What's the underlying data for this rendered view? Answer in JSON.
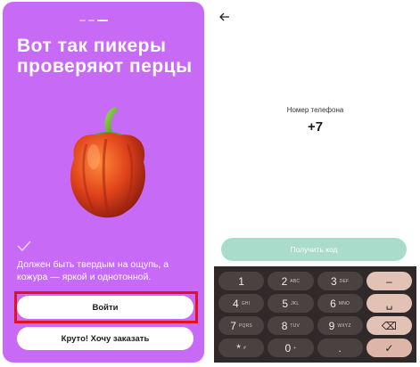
{
  "onboarding": {
    "headline": "Вот так пикеры проверяют перцы",
    "description": "Должен быть твердым на ощупь, а кожура — яркой и однотонной.",
    "login_button": "Войти",
    "order_button": "Круто! Хочу заказать",
    "pager_total": 3,
    "pager_active": 3,
    "pepper_icon": "red-bell-pepper",
    "check_icon": "check-icon"
  },
  "phone_screen": {
    "back_icon": "arrow-left-icon",
    "phone_label": "Номер телефона",
    "phone_value": "+7",
    "get_code_button": "Получить код"
  },
  "keypad": {
    "keys": [
      {
        "main": "1",
        "sub": ""
      },
      {
        "main": "2",
        "sub": "ABC"
      },
      {
        "main": "3",
        "sub": "DEF"
      },
      {
        "main": "–",
        "sub": ""
      },
      {
        "main": "4",
        "sub": "GHI"
      },
      {
        "main": "5",
        "sub": "JKL"
      },
      {
        "main": "6",
        "sub": "MNO"
      },
      {
        "main": "␣",
        "sub": ""
      },
      {
        "main": "7",
        "sub": "PQRS"
      },
      {
        "main": "8",
        "sub": "TUV"
      },
      {
        "main": "9",
        "sub": "WXYZ"
      },
      {
        "main": "⌫",
        "sub": ""
      },
      {
        "main": "*",
        "sub": "#"
      },
      {
        "main": "0",
        "sub": "+"
      },
      {
        "main": ".",
        "sub": ""
      },
      {
        "main": "✓",
        "sub": ""
      }
    ]
  },
  "colors": {
    "onboarding_bg": "#c76af5",
    "highlight_border": "#e5111b",
    "get_code_bg": "#a9dccb",
    "keypad_bg": "#2f2a29",
    "key_bg": "#4a4241",
    "action_key_bg": "#e3c2b6"
  }
}
